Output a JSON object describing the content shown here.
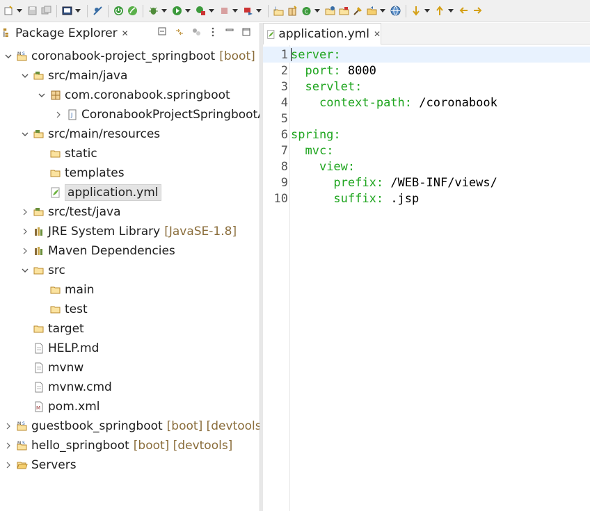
{
  "colors": {
    "yaml_key": "#1fa51f",
    "yaml_value": "#000000",
    "decoration": "#8a6d3b",
    "current_line": "#e8f2fe"
  },
  "toolbar": {
    "icons": [
      "new-icon",
      "save-icon",
      "save-all-icon",
      "terminal-icon",
      "skip-breakpoints-icon",
      "spring-boot-dashboard-icon",
      "spring-icon",
      "debug-icon",
      "run-icon",
      "run-external-icon",
      "stop-icon",
      "deploy-icon",
      "new-java-project-icon",
      "new-package-icon",
      "new-class-icon",
      "open-type-icon",
      "open-task-icon",
      "search-icon",
      "open-perspective-icon",
      "web-browser-icon",
      "next-annotation-icon",
      "previous-annotation-icon",
      "back-icon",
      "forward-icon"
    ]
  },
  "package_explorer": {
    "tab_label": "Package Explorer",
    "tree": [
      {
        "label": "coronabook-project_springboot",
        "decoration": "[boot] [",
        "icon": "maven-project-icon",
        "expanded": true,
        "depth": 0
      },
      {
        "label": "src/main/java",
        "icon": "source-folder-icon",
        "expanded": true,
        "depth": 1
      },
      {
        "label": "com.coronabook.springboot",
        "icon": "package-icon",
        "expanded": true,
        "depth": 2
      },
      {
        "label": "CoronabookProjectSpringbootA",
        "icon": "java-file-icon",
        "expanded": false,
        "depth": 3
      },
      {
        "label": "src/main/resources",
        "icon": "source-folder-icon",
        "expanded": true,
        "depth": 1
      },
      {
        "label": "static",
        "icon": "folder-icon",
        "depth": 2
      },
      {
        "label": "templates",
        "icon": "folder-icon",
        "depth": 2
      },
      {
        "label": "application.yml",
        "icon": "spring-yml-icon",
        "depth": 2,
        "selected": true
      },
      {
        "label": "src/test/java",
        "icon": "source-folder-icon",
        "expanded": false,
        "depth": 1
      },
      {
        "label": "JRE System Library",
        "decoration": "[JavaSE-1.8]",
        "icon": "library-icon",
        "expanded": false,
        "depth": 1
      },
      {
        "label": "Maven Dependencies",
        "icon": "library-icon",
        "expanded": false,
        "depth": 1
      },
      {
        "label": "src",
        "icon": "folder-icon",
        "expanded": true,
        "depth": 1
      },
      {
        "label": "main",
        "icon": "folder-icon",
        "depth": 2
      },
      {
        "label": "test",
        "icon": "folder-icon",
        "depth": 2
      },
      {
        "label": "target",
        "icon": "folder-icon",
        "depth": 1
      },
      {
        "label": "HELP.md",
        "icon": "file-icon",
        "depth": 1
      },
      {
        "label": "mvnw",
        "icon": "file-icon",
        "depth": 1
      },
      {
        "label": "mvnw.cmd",
        "icon": "file-icon",
        "depth": 1
      },
      {
        "label": "pom.xml",
        "icon": "pom-file-icon",
        "depth": 1
      },
      {
        "label": "guestbook_springboot",
        "decoration": "[boot] [devtools]",
        "icon": "maven-project-icon",
        "expanded": false,
        "depth": 0
      },
      {
        "label": "hello_springboot",
        "decoration": "[boot] [devtools]",
        "icon": "maven-project-icon",
        "expanded": false,
        "depth": 0
      },
      {
        "label": "Servers",
        "icon": "open-folder-icon",
        "expanded": false,
        "depth": 0
      }
    ]
  },
  "editor": {
    "tab_label": "application.yml",
    "lines": [
      {
        "n": "1",
        "indent": "",
        "key": "server:",
        "value": ""
      },
      {
        "n": "2",
        "indent": "  ",
        "key": "port:",
        "value": " 8000"
      },
      {
        "n": "3",
        "indent": "  ",
        "key": "servlet:",
        "value": ""
      },
      {
        "n": "4",
        "indent": "    ",
        "key": "context-path:",
        "value": " /coronabook"
      },
      {
        "n": "5",
        "indent": "",
        "key": "",
        "value": ""
      },
      {
        "n": "6",
        "indent": "",
        "key": "spring:",
        "value": ""
      },
      {
        "n": "7",
        "indent": "  ",
        "key": "mvc:",
        "value": ""
      },
      {
        "n": "8",
        "indent": "    ",
        "key": "view:",
        "value": ""
      },
      {
        "n": "9",
        "indent": "      ",
        "key": "prefix:",
        "value": " /WEB-INF/views/"
      },
      {
        "n": "10",
        "indent": "      ",
        "key": "suffix:",
        "value": " .jsp"
      }
    ]
  }
}
